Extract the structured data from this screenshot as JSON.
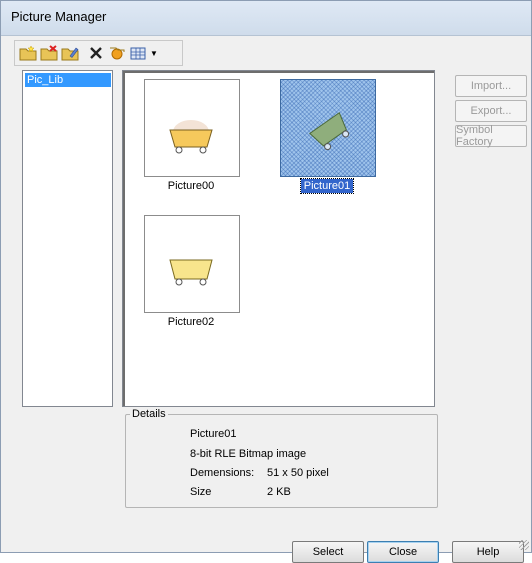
{
  "window": {
    "title": "Picture Manager"
  },
  "toolbar": {
    "buttons": [
      {
        "icon": "new-folder-icon"
      },
      {
        "icon": "delete-folder-icon"
      },
      {
        "icon": "rename-folder-icon"
      },
      {
        "icon": "delete-icon"
      },
      {
        "icon": "add-picture-icon"
      },
      {
        "icon": "view-icon"
      }
    ]
  },
  "library": {
    "items": [
      {
        "label": "Pic_Lib",
        "selected": true
      }
    ]
  },
  "pictures": [
    {
      "name": "Picture00",
      "selected": false
    },
    {
      "name": "Picture01",
      "selected": true
    },
    {
      "name": "Picture02",
      "selected": false
    }
  ],
  "side_buttons": {
    "import": "Import...",
    "export": "Export...",
    "symbol_factory": "Symbol Factory"
  },
  "details": {
    "legend": "Details",
    "name": "Picture01",
    "format": "8-bit RLE Bitmap image",
    "dimensions_label": "Demensions:",
    "dimensions_value": "51 x 50 pixel",
    "size_label": "Size",
    "size_value": "2 KB"
  },
  "buttons": {
    "select": "Select",
    "close": "Close",
    "help": "Help"
  },
  "colors": {
    "selection": "#3399ff",
    "cart_fill": "#f6d36b",
    "selected_pic_fill": "#9fc4ec"
  }
}
